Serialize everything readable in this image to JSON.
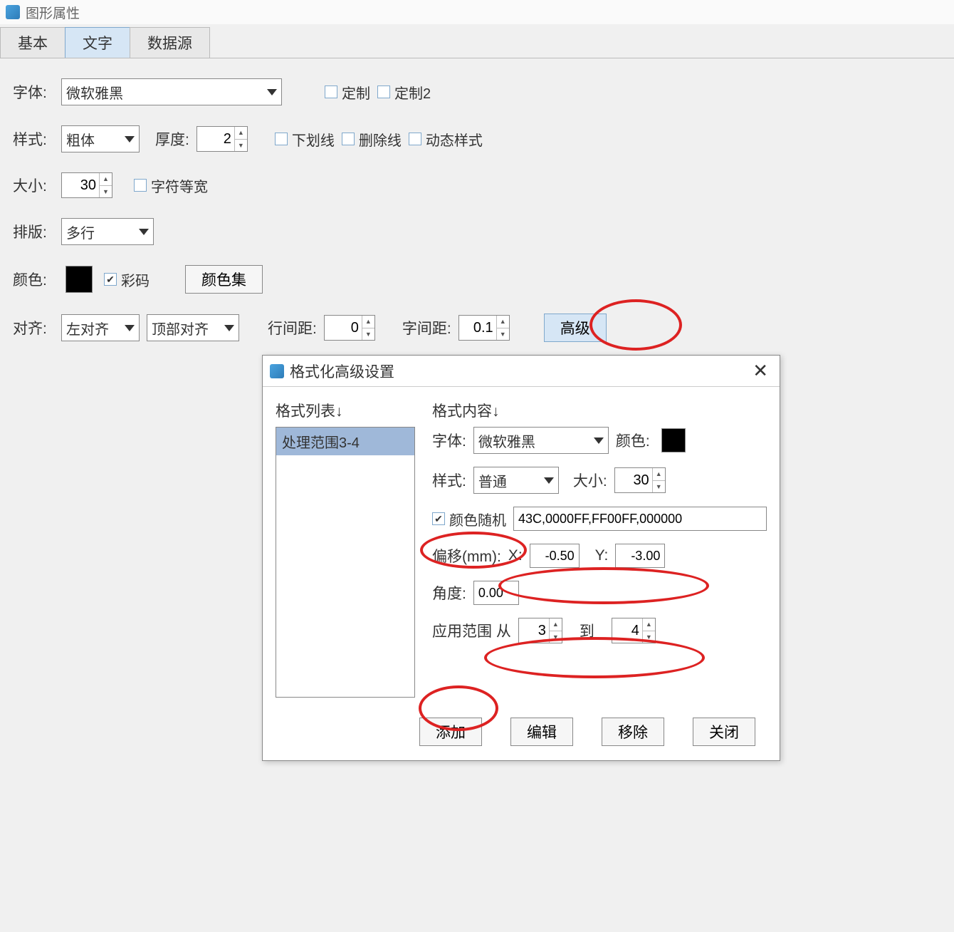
{
  "window": {
    "title": "图形属性"
  },
  "tabs": [
    "基本",
    "文字",
    "数据源"
  ],
  "active_tab": 1,
  "form": {
    "font_label": "字体:",
    "font_value": "微软雅黑",
    "custom1_label": "定制",
    "custom2_label": "定制2",
    "style_label": "样式:",
    "style_value": "粗体",
    "thickness_label": "厚度:",
    "thickness_value": "2",
    "underline_label": "下划线",
    "strike_label": "删除线",
    "dynstyle_label": "动态样式",
    "size_label": "大小:",
    "size_value": "30",
    "mono_label": "字符等宽",
    "layout_label": "排版:",
    "layout_value": "多行",
    "color_label": "颜色:",
    "color_code_label": "彩码",
    "color_set_btn": "颜色集",
    "align_label": "对齐:",
    "align_h_value": "左对齐",
    "align_v_value": "顶部对齐",
    "line_spacing_label": "行间距:",
    "line_spacing_value": "0",
    "char_spacing_label": "字间距:",
    "char_spacing_value": "0.1",
    "advanced_btn": "高级"
  },
  "dialog": {
    "title": "格式化高级设置",
    "list_head": "格式列表↓",
    "content_head": "格式内容↓",
    "list_items": [
      "处理范围3-4"
    ],
    "font_label": "字体:",
    "font_value": "微软雅黑",
    "color_label": "颜色:",
    "style_label": "样式:",
    "style_value": "普通",
    "size_label": "大小:",
    "size_value": "30",
    "random_color_label": "颜色随机",
    "color_list_value": "43C,0000FF,FF00FF,000000",
    "offset_label": "偏移(mm):",
    "x_label": "X:",
    "x_value": "-0.50",
    "y_label": "Y:",
    "y_value": "-3.00",
    "angle_label": "角度:",
    "angle_value": "0.00",
    "range_label": "应用范围  从",
    "range_from_value": "3",
    "range_to_label": "到",
    "range_to_value": "4",
    "btn_add": "添加",
    "btn_edit": "编辑",
    "btn_remove": "移除",
    "btn_close": "关闭"
  }
}
